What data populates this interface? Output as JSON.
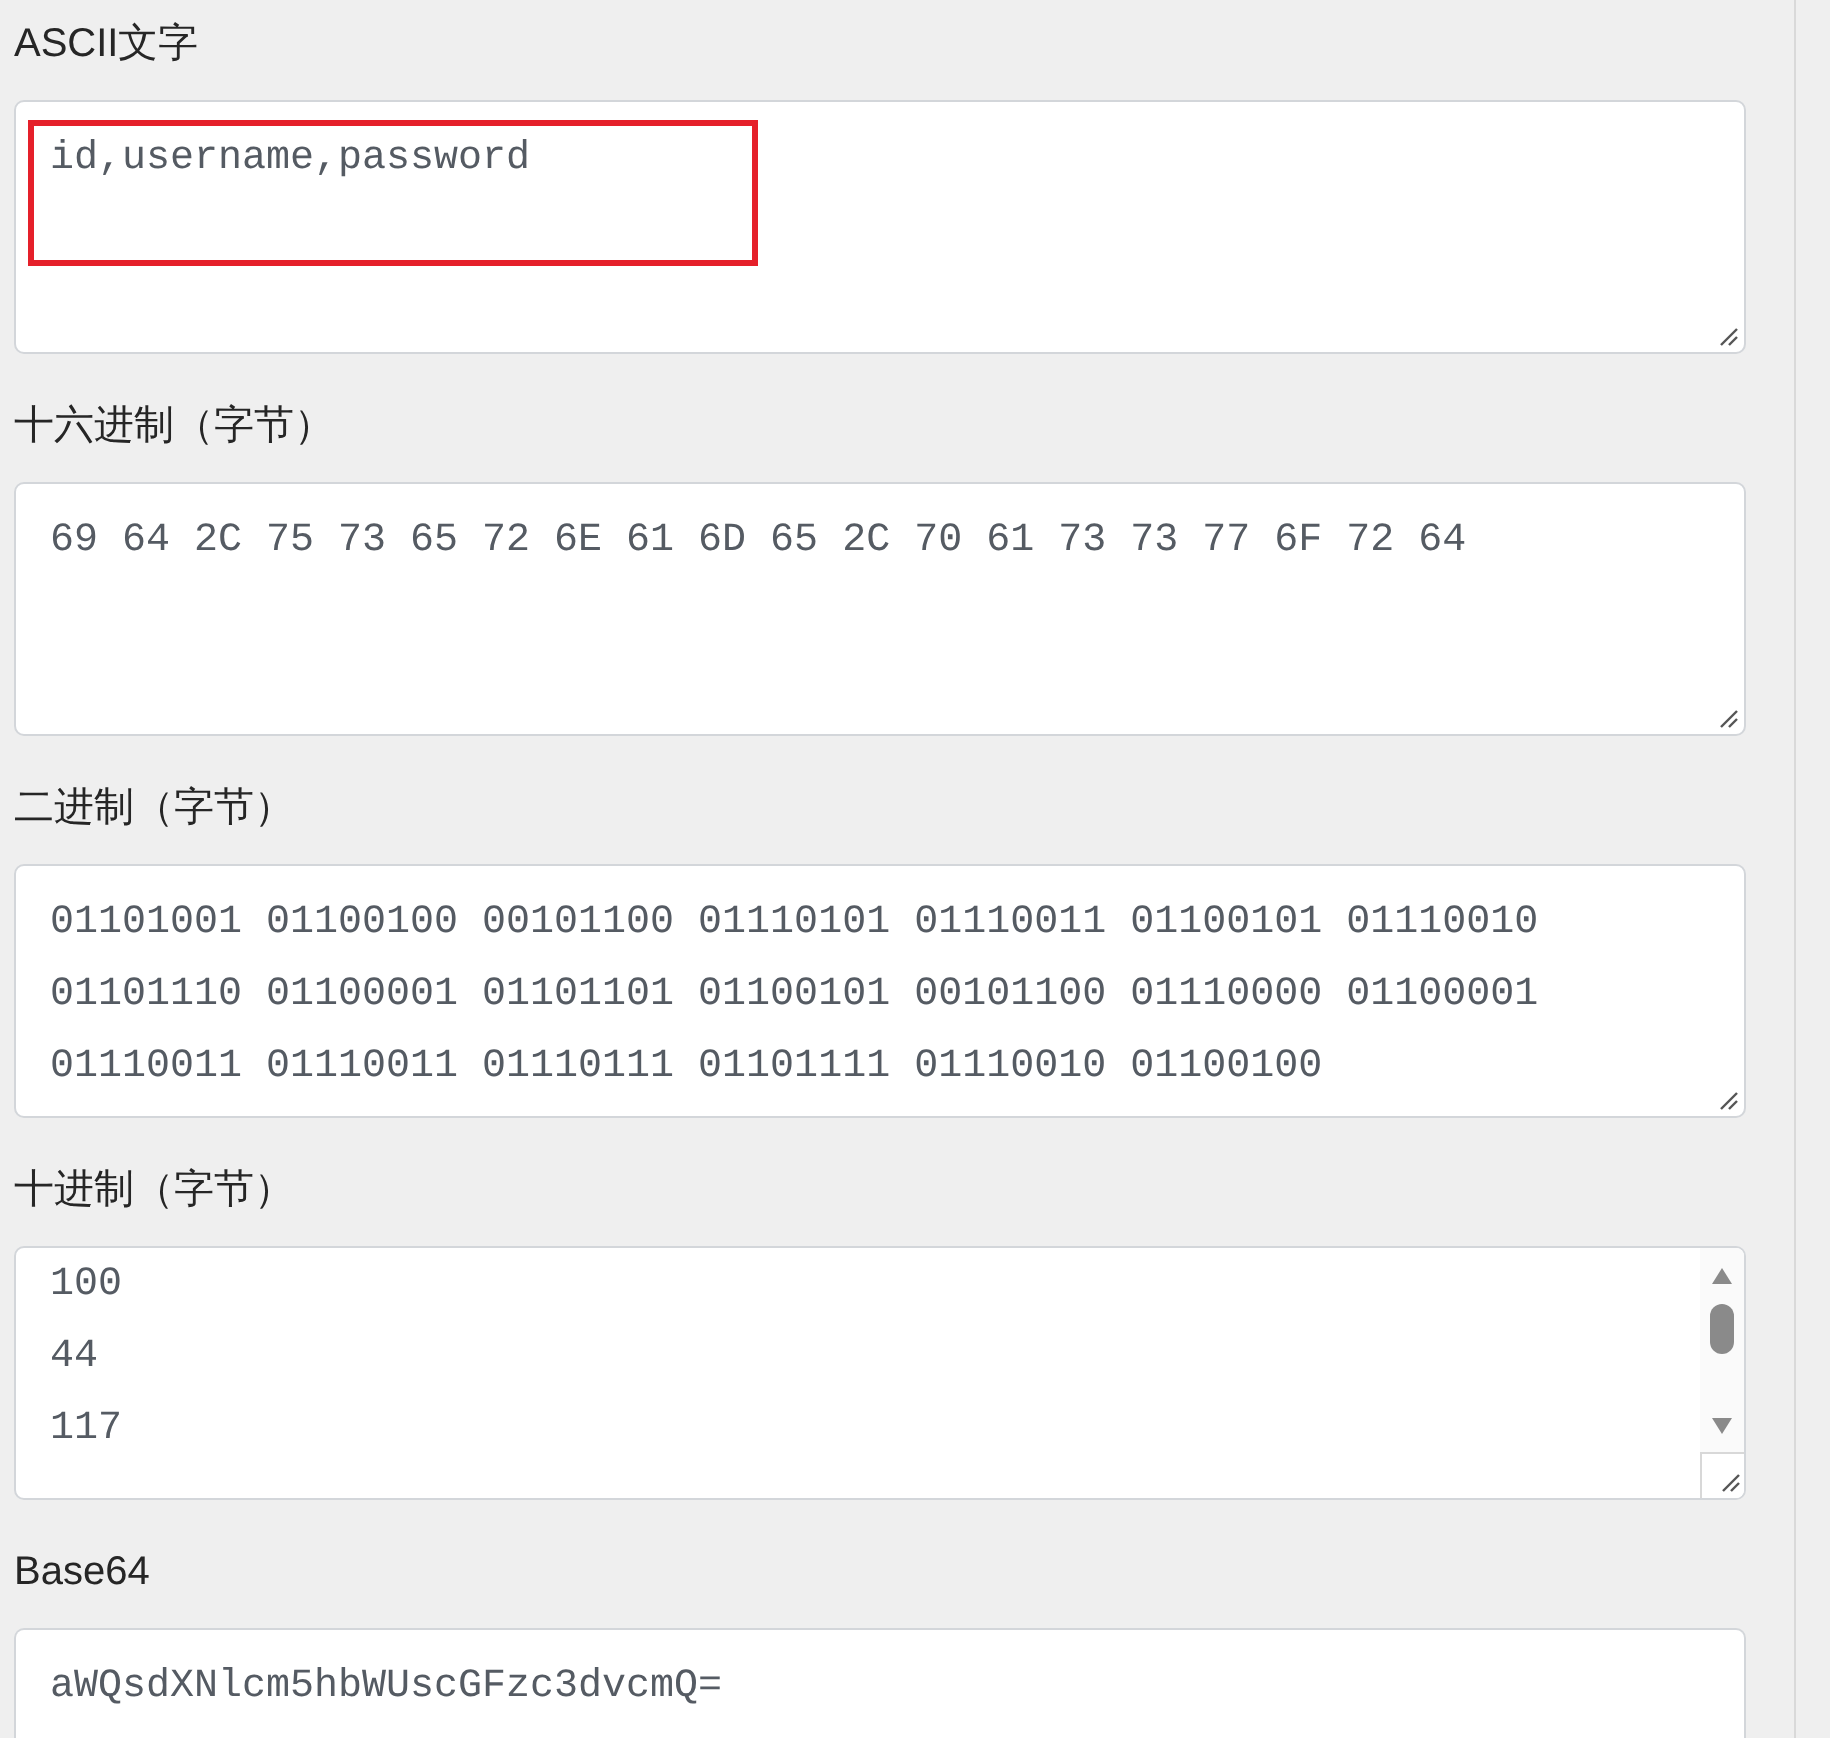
{
  "fields": [
    {
      "label": "ASCII文字",
      "kind": "text",
      "value": "id,username,password",
      "highlighted": true
    },
    {
      "label": "十六进制（字节）",
      "kind": "text",
      "value": "69 64 2C 75 73 65 72 6E 61 6D 65 2C 70 61 73 73 77 6F 72 64",
      "highlighted": false
    },
    {
      "label": "二进制（字节）",
      "kind": "text",
      "value": "01101001 01100100 00101100 01110101 01110011 01100101 01110010 01101110 01100001 01101101 01100101 00101100 01110000 01100001 01110011 01110011 01110111 01101111 01110010 01100100",
      "highlighted": false
    },
    {
      "label": "十进制（字节）",
      "kind": "scrolled",
      "lines": [
        "100",
        "44",
        "117"
      ],
      "highlighted": false
    },
    {
      "label": "Base64",
      "kind": "text",
      "value": "aWQsdXNlcm5hbWUscGFzc3dvcmQ=",
      "highlighted": false
    }
  ]
}
